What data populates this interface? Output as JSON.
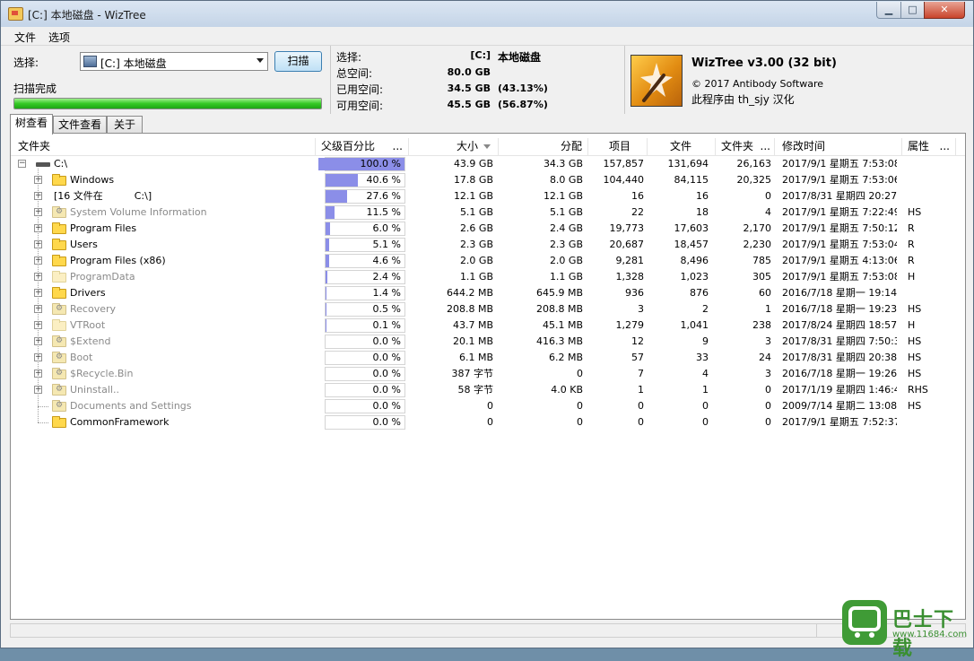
{
  "window": {
    "title": "[C:] 本地磁盘  - WizTree",
    "btn_min": "▁",
    "btn_max": "□",
    "btn_close": "✕"
  },
  "menu": {
    "file": "文件",
    "options": "选项"
  },
  "scan": {
    "select_label": "选择:",
    "drive_value": "[C:] 本地磁盘",
    "scan_button": "扫描",
    "status": "扫描完成",
    "progress": 1.0
  },
  "stats": {
    "selected_label": "选择:",
    "selected_drive": "[C:]",
    "selected_name": "本地磁盘",
    "total_label": "总空间:",
    "total_value": "80.0 GB",
    "used_label": "已用空间:",
    "used_value": "34.5 GB",
    "used_pct": "(43.13%)",
    "free_label": "可用空间:",
    "free_value": "45.5 GB",
    "free_pct": "(56.87%)"
  },
  "about": {
    "title": "WizTree v3.00 (32 bit)",
    "copyright": "© 2017 Antibody Software",
    "localized": "此程序由 th_sjy 汉化"
  },
  "tabs": [
    "树查看",
    "文件查看",
    "关于"
  ],
  "columns": {
    "folder": "文件夹",
    "parent_pct": "父级百分比",
    "parent_pct_more": "...",
    "size": "大小",
    "allocated": "分配",
    "items": "项目",
    "files": "文件",
    "folders": "文件夹",
    "folders_more": "...",
    "modified": "修改时间",
    "attributes": "属性",
    "attributes_more": "..."
  },
  "rows": [
    {
      "name": "C:\\",
      "pct": "100.0 %",
      "pct_value": 100.0,
      "size": "43.9 GB",
      "alloc": "34.3 GB",
      "items": "157,857",
      "files": "131,694",
      "folders": "26,163",
      "modified": "2017/9/1 星期五 7:53:08",
      "attr": ""
    },
    {
      "name": "Windows",
      "pct": "40.6 %",
      "pct_value": 40.6,
      "size": "17.8 GB",
      "alloc": "8.0 GB",
      "items": "104,440",
      "files": "84,115",
      "folders": "20,325",
      "modified": "2017/9/1 星期五 7:53:06",
      "attr": ""
    },
    {
      "name": "[16 文件在          C:\\]",
      "pct": "27.6 %",
      "pct_value": 27.6,
      "size": "12.1 GB",
      "alloc": "12.1 GB",
      "items": "16",
      "files": "16",
      "folders": "0",
      "modified": "2017/8/31 星期四 20:27:5",
      "attr": ""
    },
    {
      "name": "System Volume Information",
      "pct": "11.5 %",
      "pct_value": 11.5,
      "size": "5.1 GB",
      "alloc": "5.1 GB",
      "items": "22",
      "files": "18",
      "folders": "4",
      "modified": "2017/9/1 星期五 7:22:49",
      "attr": "HS"
    },
    {
      "name": "Program Files",
      "pct": "6.0 %",
      "pct_value": 6.0,
      "size": "2.6 GB",
      "alloc": "2.4 GB",
      "items": "19,773",
      "files": "17,603",
      "folders": "2,170",
      "modified": "2017/9/1 星期五 7:50:12",
      "attr": "R"
    },
    {
      "name": "Users",
      "pct": "5.1 %",
      "pct_value": 5.1,
      "size": "2.3 GB",
      "alloc": "2.3 GB",
      "items": "20,687",
      "files": "18,457",
      "folders": "2,230",
      "modified": "2017/9/1 星期五 7:53:04",
      "attr": "R"
    },
    {
      "name": "Program Files (x86)",
      "pct": "4.6 %",
      "pct_value": 4.6,
      "size": "2.0 GB",
      "alloc": "2.0 GB",
      "items": "9,281",
      "files": "8,496",
      "folders": "785",
      "modified": "2017/9/1 星期五 4:13:06",
      "attr": "R"
    },
    {
      "name": "ProgramData",
      "pct": "2.4 %",
      "pct_value": 2.4,
      "size": "1.1 GB",
      "alloc": "1.1 GB",
      "items": "1,328",
      "files": "1,023",
      "folders": "305",
      "modified": "2017/9/1 星期五 7:53:08",
      "attr": "H"
    },
    {
      "name": "Drivers",
      "pct": "1.4 %",
      "pct_value": 1.4,
      "size": "644.2 MB",
      "alloc": "645.9 MB",
      "items": "936",
      "files": "876",
      "folders": "60",
      "modified": "2016/7/18 星期一 19:14:2",
      "attr": ""
    },
    {
      "name": "Recovery",
      "pct": "0.5 %",
      "pct_value": 0.5,
      "size": "208.8 MB",
      "alloc": "208.8 MB",
      "items": "3",
      "files": "2",
      "folders": "1",
      "modified": "2016/7/18 星期一 19:23:3",
      "attr": "HS"
    },
    {
      "name": "VTRoot",
      "pct": "0.1 %",
      "pct_value": 0.1,
      "size": "43.7 MB",
      "alloc": "45.1 MB",
      "items": "1,279",
      "files": "1,041",
      "folders": "238",
      "modified": "2017/8/24 星期四 18:57:0",
      "attr": "H"
    },
    {
      "name": "$Extend",
      "pct": "0.0 %",
      "pct_value": 0.0,
      "size": "20.1 MB",
      "alloc": "416.3 MB",
      "items": "12",
      "files": "9",
      "folders": "3",
      "modified": "2017/8/31 星期四 7:50:3",
      "attr": "HS"
    },
    {
      "name": "Boot",
      "pct": "0.0 %",
      "pct_value": 0.0,
      "size": "6.1 MB",
      "alloc": "6.2 MB",
      "items": "57",
      "files": "33",
      "folders": "24",
      "modified": "2017/8/31 星期四 20:38:1",
      "attr": "HS"
    },
    {
      "name": "$Recycle.Bin",
      "pct": "0.0 %",
      "pct_value": 0.0,
      "size": "387 字节",
      "alloc": "0",
      "items": "7",
      "files": "4",
      "folders": "3",
      "modified": "2016/7/18 星期一 19:26:4",
      "attr": "HS"
    },
    {
      "name": "Uninstall..",
      "pct": "0.0 %",
      "pct_value": 0.0,
      "size": "58 字节",
      "alloc": "4.0 KB",
      "items": "1",
      "files": "1",
      "folders": "0",
      "modified": "2017/1/19 星期四 1:46:40",
      "attr": "RHS"
    },
    {
      "name": "Documents and Settings",
      "pct": "0.0 %",
      "pct_value": 0.0,
      "size": "0",
      "alloc": "0",
      "items": "0",
      "files": "0",
      "folders": "0",
      "modified": "2009/7/14 星期二 13:08:5",
      "attr": "HS"
    },
    {
      "name": "CommonFramework",
      "pct": "0.0 %",
      "pct_value": 0.0,
      "size": "0",
      "alloc": "0",
      "items": "0",
      "files": "0",
      "folders": "0",
      "modified": "2017/9/1 星期五 7:52:37",
      "attr": ""
    }
  ],
  "watermark": {
    "brand": "巴士下载",
    "url": "www.11684.com"
  }
}
